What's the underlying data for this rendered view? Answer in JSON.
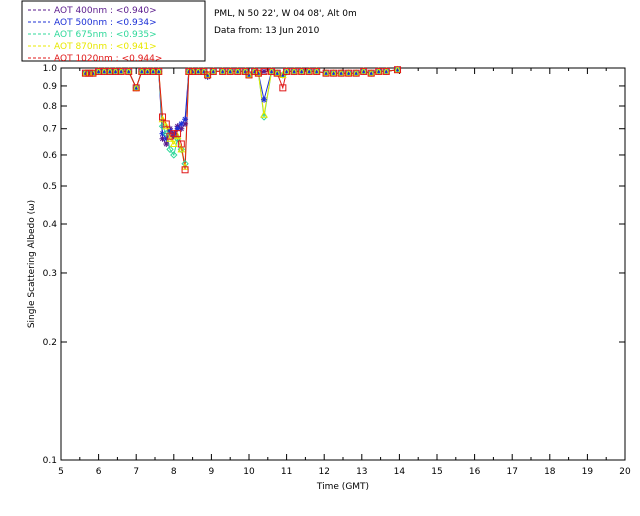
{
  "chart_data": {
    "type": "line",
    "header_lines": [
      "PML, N 50 22', W 04 08', Alt 0m",
      "Data from: 13 Jun 2010"
    ],
    "xlabel": "Time (GMT)",
    "ylabel": "Single Scattering Albedo (ω)",
    "xlim": [
      5,
      20
    ],
    "ylim": [
      0.1,
      1.0
    ],
    "yscale": "log",
    "grid": false,
    "legend_position": "top-left",
    "x_ticks": [
      5,
      6,
      7,
      8,
      9,
      10,
      11,
      12,
      13,
      14,
      15,
      16,
      17,
      18,
      19,
      20
    ],
    "x_tick_labels": [
      "5",
      "6",
      "7",
      "8",
      "9",
      "10",
      "11",
      "12",
      "13",
      "14",
      "15",
      "16",
      "17",
      "18",
      "19",
      "20"
    ],
    "y_ticks": [
      1.0,
      0.9,
      0.8,
      0.7,
      0.6,
      0.5,
      0.4,
      0.3,
      0.2,
      0.1
    ],
    "y_tick_labels": [
      "1.0",
      "0.9",
      "0.8",
      "0.7",
      "0.6",
      "0.5",
      "0.4",
      "0.3",
      "0.2",
      "0.1"
    ],
    "x": [
      5.65,
      5.75,
      5.85,
      6.0,
      6.15,
      6.3,
      6.45,
      6.6,
      6.8,
      7.0,
      7.15,
      7.3,
      7.45,
      7.6,
      7.7,
      7.8,
      7.9,
      8.0,
      8.1,
      8.2,
      8.3,
      8.4,
      8.5,
      8.65,
      8.8,
      8.9,
      9.05,
      9.3,
      9.5,
      9.7,
      9.9,
      10.0,
      10.15,
      10.25,
      10.4,
      10.6,
      10.75,
      10.9,
      11.0,
      11.2,
      11.4,
      11.6,
      11.8,
      12.05,
      12.25,
      12.45,
      12.65,
      12.85,
      13.05,
      13.25,
      13.45,
      13.65,
      13.95
    ],
    "series": [
      {
        "name": "AOT  400nm : <0.940>",
        "color": "#5a1a8c",
        "values": [
          0.97,
          0.97,
          0.97,
          0.98,
          0.98,
          0.98,
          0.98,
          0.98,
          0.98,
          0.89,
          0.98,
          0.98,
          0.98,
          0.98,
          0.66,
          0.64,
          0.7,
          0.68,
          0.71,
          0.7,
          0.72,
          0.98,
          0.98,
          0.98,
          0.98,
          0.95,
          0.98,
          0.98,
          0.98,
          0.98,
          0.98,
          0.96,
          0.98,
          0.97,
          0.98,
          0.98,
          0.97,
          0.96,
          0.98,
          0.98,
          0.98,
          0.98,
          0.98,
          0.97,
          0.97,
          0.97,
          0.97,
          0.97,
          0.98,
          0.97,
          0.98,
          0.98,
          0.99
        ]
      },
      {
        "name": "AOT  500nm : <0.934>",
        "color": "#1c2fd6",
        "values": [
          0.97,
          0.97,
          0.97,
          0.98,
          0.98,
          0.98,
          0.98,
          0.98,
          0.98,
          0.89,
          0.98,
          0.98,
          0.98,
          0.98,
          0.68,
          0.66,
          0.69,
          0.67,
          0.7,
          0.72,
          0.74,
          0.98,
          0.98,
          0.98,
          0.98,
          0.95,
          0.98,
          0.98,
          0.98,
          0.98,
          0.98,
          0.96,
          0.98,
          0.97,
          0.83,
          0.98,
          0.97,
          0.96,
          0.98,
          0.98,
          0.98,
          0.98,
          0.98,
          0.97,
          0.97,
          0.97,
          0.97,
          0.97,
          0.98,
          0.97,
          0.98,
          0.98,
          0.99
        ]
      },
      {
        "name": "AOT  675nm : <0.935>",
        "color": "#2fd89a",
        "values": [
          0.97,
          0.97,
          0.97,
          0.98,
          0.98,
          0.98,
          0.98,
          0.98,
          0.98,
          0.89,
          0.98,
          0.98,
          0.98,
          0.98,
          0.71,
          0.68,
          0.62,
          0.6,
          0.66,
          0.62,
          0.57,
          0.98,
          0.98,
          0.98,
          0.98,
          0.96,
          0.98,
          0.98,
          0.98,
          0.98,
          0.98,
          0.96,
          0.98,
          0.97,
          0.75,
          0.98,
          0.97,
          0.96,
          0.98,
          0.98,
          0.98,
          0.98,
          0.98,
          0.97,
          0.97,
          0.97,
          0.97,
          0.97,
          0.98,
          0.97,
          0.98,
          0.98,
          0.99
        ]
      },
      {
        "name": "AOT  870nm : <0.941>",
        "color": "#e8e800",
        "values": [
          0.97,
          0.97,
          0.97,
          0.98,
          0.98,
          0.98,
          0.98,
          0.98,
          0.98,
          0.89,
          0.98,
          0.98,
          0.98,
          0.98,
          0.74,
          0.71,
          0.66,
          0.64,
          0.67,
          0.62,
          0.56,
          0.98,
          0.98,
          0.98,
          0.98,
          0.96,
          0.98,
          0.98,
          0.98,
          0.98,
          0.98,
          0.96,
          0.98,
          0.97,
          0.76,
          0.98,
          0.97,
          0.96,
          0.98,
          0.98,
          0.98,
          0.98,
          0.98,
          0.97,
          0.97,
          0.97,
          0.97,
          0.97,
          0.98,
          0.97,
          0.98,
          0.98,
          0.99
        ]
      },
      {
        "name": "AOT 1020nm : <0.944>",
        "color": "#e01818",
        "values": [
          0.97,
          0.97,
          0.97,
          0.98,
          0.98,
          0.98,
          0.98,
          0.98,
          0.98,
          0.89,
          0.98,
          0.98,
          0.98,
          0.98,
          0.75,
          0.72,
          0.67,
          0.68,
          0.68,
          0.64,
          0.55,
          0.98,
          0.98,
          0.98,
          0.98,
          0.96,
          0.98,
          0.98,
          0.98,
          0.98,
          0.98,
          0.96,
          0.98,
          0.97,
          0.98,
          0.98,
          0.97,
          0.89,
          0.98,
          0.98,
          0.98,
          0.98,
          0.98,
          0.97,
          0.97,
          0.97,
          0.97,
          0.97,
          0.98,
          0.97,
          0.98,
          0.98,
          0.99
        ]
      }
    ]
  }
}
